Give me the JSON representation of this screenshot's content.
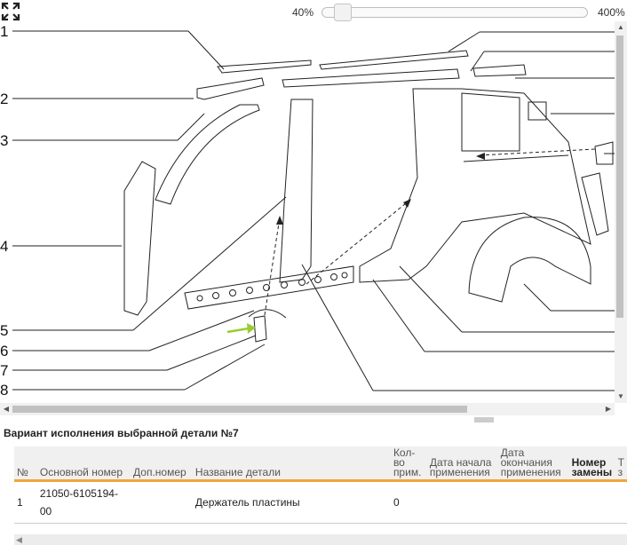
{
  "zoom": {
    "min_label": "40%",
    "max_label": "400%",
    "level_percent": 40
  },
  "callouts": [
    "1",
    "2",
    "3",
    "4",
    "5",
    "6",
    "7",
    "8"
  ],
  "section": {
    "title": "Вариант исполнения выбранной детали №7"
  },
  "table": {
    "headers": [
      "№",
      "Основной номер",
      "Доп.номер",
      "Название детали",
      "Кол-во прим.",
      "Дата начала применения",
      "Дата окончания применения",
      "Номер замены",
      "Т з"
    ],
    "rows": [
      {
        "num": "1",
        "main_number": "21050-6105194-00",
        "extra_number": "",
        "name": "Держатель пластины",
        "qty": "0",
        "start_date": "",
        "end_date": "",
        "replacement": ""
      }
    ]
  },
  "colors": {
    "accent": "#f0a63a",
    "highlight_arrow": "#9acd32"
  }
}
